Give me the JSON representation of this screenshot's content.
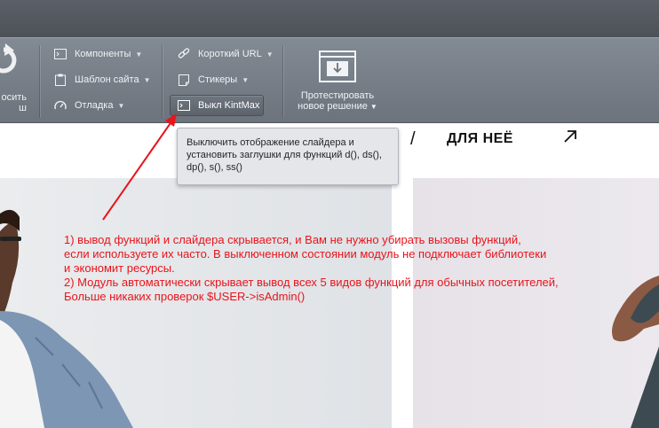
{
  "toolbar": {
    "refresh_label": "осить\nш",
    "components": {
      "label": "Компоненты",
      "icon": "components-icon"
    },
    "site_template": {
      "label": "Шаблон сайта",
      "icon": "clipboard-icon"
    },
    "debug": {
      "label": "Отладка",
      "icon": "gauge-icon"
    },
    "short_url": {
      "label": "Короткий URL",
      "icon": "link-icon"
    },
    "stickers": {
      "label": "Стикеры",
      "icon": "sticker-icon"
    },
    "kintmax_button": {
      "label": "Выкл KintMax",
      "icon": "terminal-icon"
    },
    "test_solution": {
      "line1": "Протестировать",
      "line2": "новое решение",
      "icon": "browser-download-icon"
    }
  },
  "tooltip": {
    "text": "Выключить отображение слайдера и установить заглушки для функций d(), ds(), dp(), s(), ss()"
  },
  "nav": {
    "separator": "/",
    "item": "ДЛЯ НЕЁ",
    "arrow_icon": "arrow-up-right-icon"
  },
  "annotation": {
    "lines": [
      "1) вывод функций и слайдера скрывается, и Вам не нужно убирать вызовы функций,",
      "если используете их часто. В выключенном состоянии модуль не подключает библиотеки",
      "и экономит ресурсы.",
      "2) Модуль автоматически скрывает вывод всех 5 видов функций для обычных посетителей,",
      "Больше никаких проверок $USER->isAdmin()"
    ],
    "color": "#e8141b"
  },
  "colors": {
    "toolbar": "#767d86",
    "top_strip": "#54585f",
    "tooltip_bg": "#e4e6e9"
  }
}
